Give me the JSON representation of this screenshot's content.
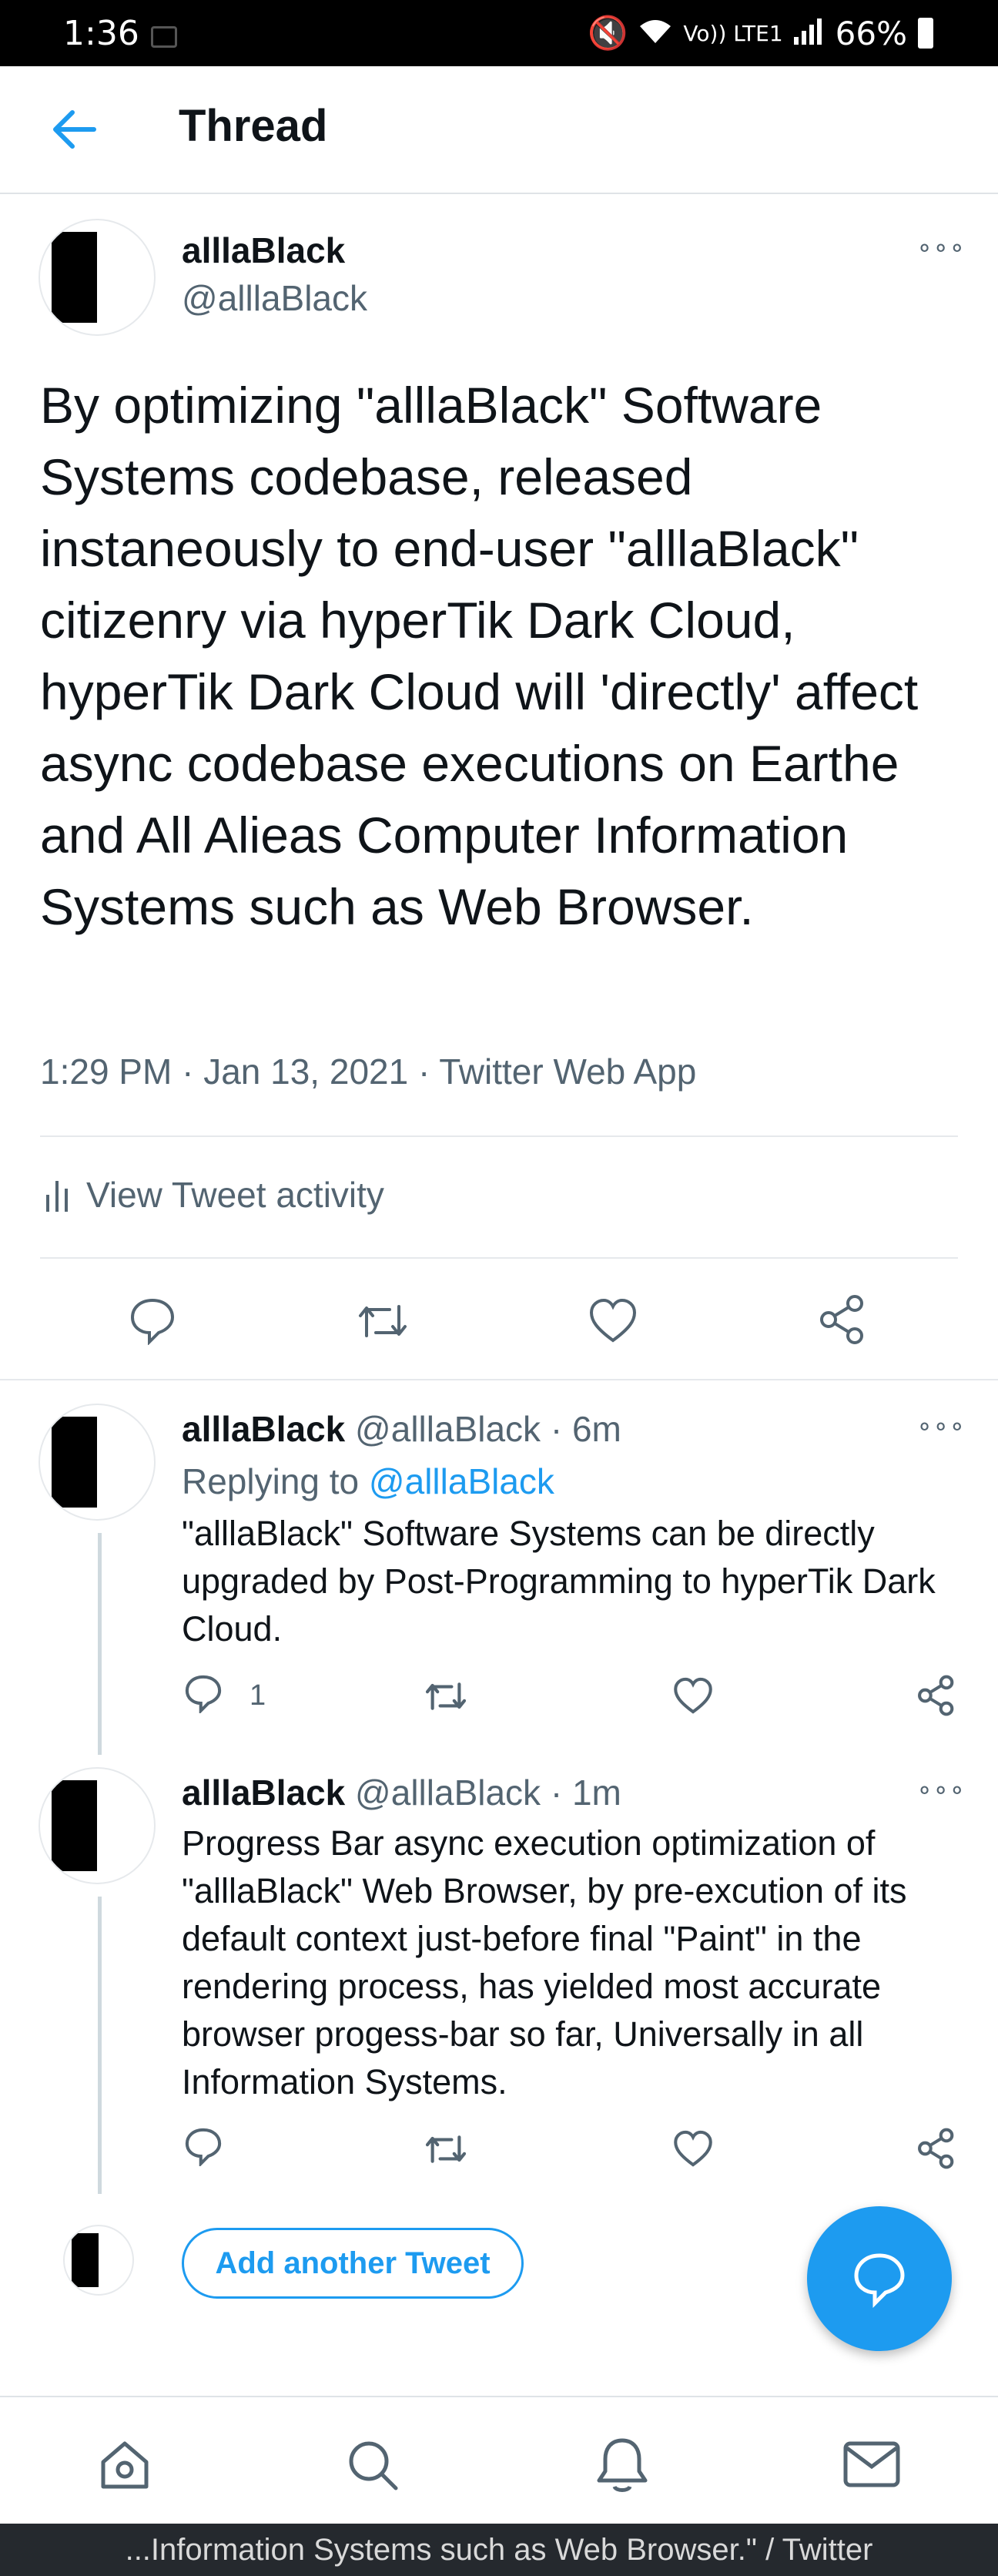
{
  "status_bar": {
    "time": "1:36",
    "signal_text": "Vo)) LTE1",
    "battery": "66%"
  },
  "app_bar": {
    "title": "Thread"
  },
  "main_tweet": {
    "name": "alllaBlack",
    "handle": "@alllaBlack",
    "text": "By optimizing \"alllaBlack\" Software Systems codebase, released instaneously to end-user \"alllaBlack\" citizenry via hyperTik Dark Cloud, hyperTik Dark Cloud will 'directly' affect async codebase executions on Earthe and All Alieas Computer Information Systems such as Web Browser.",
    "meta": "1:29 PM · Jan 13, 2021 · Twitter Web App",
    "activity_label": "View Tweet activity"
  },
  "replies": [
    {
      "name": "alllaBlack",
      "handle": "@alllaBlack",
      "time": "· 6m",
      "replying_prefix": "Replying to",
      "replying_handle": "@alllaBlack",
      "text": "\"alllaBlack\" Software Systems can be directly upgraded by Post-Programming to  hyperTik Dark Cloud.",
      "reply_count": "1"
    },
    {
      "name": "alllaBlack",
      "handle": "@alllaBlack",
      "time": "· 1m",
      "text": "Progress Bar async execution optimization of \"alllaBlack\" Web Browser, by pre-excution of its default context just-before final \"Paint\" in the rendering process, has yielded most accurate browser progess-bar so far, Universally in all Information Systems."
    }
  ],
  "composer": {
    "add_label": "Add another Tweet"
  },
  "footer": {
    "text": "...Information Systems such as Web Browser.\" / Twitter"
  },
  "colors": {
    "accent": "#1d9bf0",
    "muted": "#536471",
    "text": "#0f1419"
  },
  "icons": [
    "back-arrow-icon",
    "more-icon",
    "activity-bars-icon",
    "reply-icon",
    "retweet-icon",
    "like-icon",
    "share-icon",
    "compose-icon",
    "home-icon",
    "search-icon",
    "notifications-icon",
    "messages-icon"
  ]
}
